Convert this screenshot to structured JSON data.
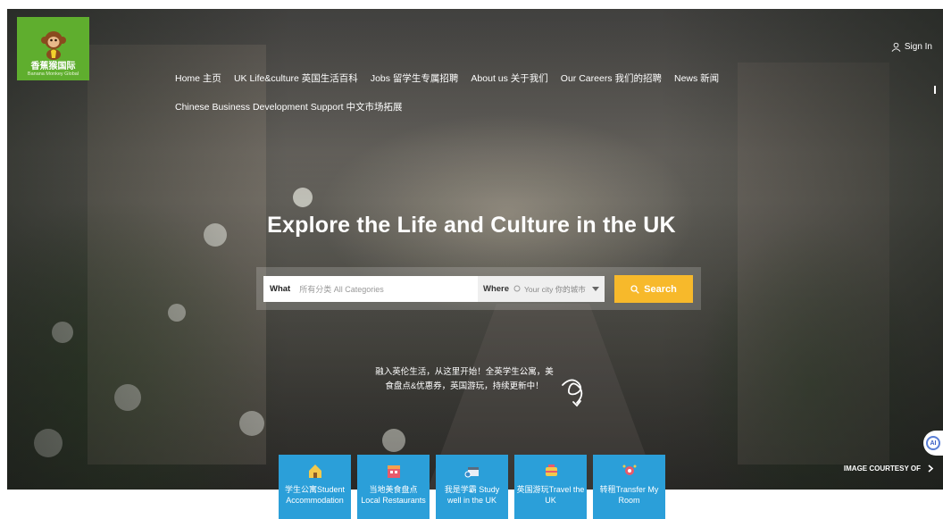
{
  "brand": {
    "logo_cn": "香蕉猴国际",
    "logo_en": "Banana Monkey Global",
    "accent": "#5fae2e"
  },
  "nav": {
    "items": [
      "Home 主页",
      "UK Life&culture 英国生活百科",
      "Jobs 留学生专属招聘",
      "About us 关于我们",
      "Our Careers 我们的招聘",
      "News 新闻"
    ],
    "second_row": "Chinese Business Development Support 中文市场拓展"
  },
  "header": {
    "sign_in": "Sign In",
    "sign_in_icon": "user-icon"
  },
  "hero": {
    "headline": "Explore the Life and Culture in the UK",
    "tagline_line1": "融入英伦生活，从这里开始！全英学生公寓，美",
    "tagline_line2": "食盘点&优惠券，英国游玩，持续更新中！",
    "courtesy": "IMAGE COURTESY OF"
  },
  "search": {
    "what_label": "What",
    "what_placeholder": "所有分类 All Categories",
    "where_label": "Where",
    "where_placeholder": "Your city 你的城市",
    "button_label": "Search",
    "button_color": "#f7b92b"
  },
  "ai_badge": "AI",
  "categories": [
    {
      "icon": "house-icon",
      "label": "学生公寓Student Accommodation"
    },
    {
      "icon": "restaurant-icon",
      "label": "当地美食盘点 Local Restaurants"
    },
    {
      "icon": "study-icon",
      "label": "我是学霸 Study well in the UK"
    },
    {
      "icon": "travel-icon",
      "label": "英国游玩Travel the UK"
    },
    {
      "icon": "transfer-icon",
      "label": "转租Transfer My Room"
    }
  ],
  "category_color": "#2b9fd9"
}
